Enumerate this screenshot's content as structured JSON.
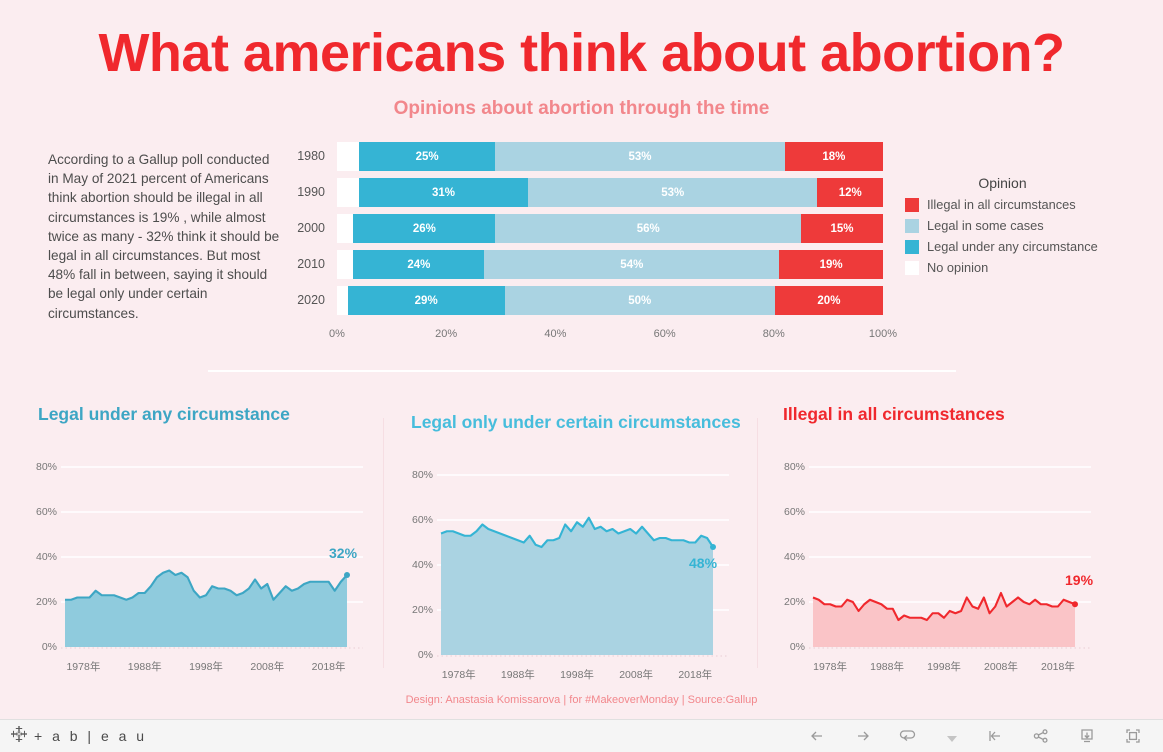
{
  "header": {
    "title": "What americans think about abortion?",
    "subtitle": "Opinions about abortion through the time"
  },
  "intro": {
    "text": "According to a Gallup poll conducted in May of 2021 percent of Americans think abortion should be illegal in all circumstances is 19% , while almost twice as many - 32% think it should be legal in all circumstances. But most 48% fall in between, saying it should be legal only under certain circumstances."
  },
  "colors": {
    "background": "#FBEDF0",
    "red": "#EE3A3A",
    "title_red": "#F0282D",
    "pink": "#F2878C",
    "teal": "#35B4D4",
    "light_blue": "#AAD3E2",
    "white": "#FFFFFF"
  },
  "legend": {
    "title": "Opinion",
    "items": [
      {
        "label": "Illegal in all circumstances",
        "color": "#EE3A3A"
      },
      {
        "label": "Legal in some cases",
        "color": "#AAD3E2"
      },
      {
        "label": "Legal under any circumstance",
        "color": "#35B4D4"
      },
      {
        "label": "No opinion",
        "color": "#FFFFFF"
      }
    ]
  },
  "chart_data": [
    {
      "type": "bar",
      "id": "stacked-opinion-by-decade",
      "orientation": "horizontal",
      "stacked": true,
      "stack_mode": "percent",
      "title": "Opinions about abortion through the time",
      "xlabel": "",
      "ylabel": "",
      "xlim": [
        0,
        100
      ],
      "grid": false,
      "legend_position": "right",
      "categories": [
        "1980",
        "1990",
        "2000",
        "2010",
        "2020"
      ],
      "xticks": [
        "0%",
        "20%",
        "40%",
        "60%",
        "80%",
        "100%"
      ],
      "xtick_values": [
        0,
        20,
        40,
        60,
        80,
        100
      ],
      "series": [
        {
          "name": "No opinion",
          "color": "#FFFFFF",
          "values": [
            4,
            4,
            3,
            3,
            2
          ],
          "labels": [
            "",
            "",
            "",
            "",
            ""
          ]
        },
        {
          "name": "Legal under any circumstance",
          "color": "#35B4D4",
          "values": [
            25,
            31,
            26,
            24,
            29
          ],
          "labels": [
            "25%",
            "31%",
            "26%",
            "24%",
            "29%"
          ]
        },
        {
          "name": "Legal in some cases",
          "color": "#AAD3E2",
          "values": [
            53,
            53,
            56,
            54,
            50
          ],
          "labels": [
            "53%",
            "53%",
            "56%",
            "54%",
            "50%"
          ]
        },
        {
          "name": "Illegal in all circumstances",
          "color": "#EE3A3A",
          "values": [
            18,
            12,
            15,
            19,
            20
          ],
          "labels": [
            "18%",
            "12%",
            "15%",
            "19%",
            "20%"
          ]
        }
      ]
    },
    {
      "type": "area",
      "id": "legal-any-circumstance",
      "title": "Legal under any circumstance",
      "title_color": "#3DA6C4",
      "line_color": "#3DA6C4",
      "fill_color": "#8FCBDD",
      "xlabel": "",
      "ylabel": "",
      "ylim": [
        0,
        88
      ],
      "yticks": [
        "0%",
        "20%",
        "40%",
        "60%",
        "80%"
      ],
      "ytick_values": [
        0,
        20,
        40,
        60,
        80
      ],
      "xticks": [
        "1978年",
        "1988年",
        "1998年",
        "2008年",
        "2018年"
      ],
      "xtick_values": [
        1978,
        1988,
        1998,
        2008,
        2018
      ],
      "end_label": "32%",
      "end_value": 32,
      "x": [
        1975,
        1976,
        1977,
        1978,
        1979,
        1980,
        1981,
        1982,
        1983,
        1984,
        1985,
        1986,
        1987,
        1988,
        1989,
        1990,
        1991,
        1992,
        1993,
        1994,
        1995,
        1996,
        1997,
        1998,
        1999,
        2000,
        2001,
        2002,
        2003,
        2004,
        2005,
        2006,
        2007,
        2008,
        2009,
        2010,
        2011,
        2012,
        2013,
        2014,
        2015,
        2016,
        2017,
        2018,
        2019,
        2020,
        2021
      ],
      "values": [
        21,
        21,
        22,
        22,
        22,
        25,
        23,
        23,
        23,
        22,
        21,
        22,
        24,
        24,
        27,
        31,
        33,
        34,
        32,
        33,
        31,
        25,
        22,
        23,
        27,
        26,
        26,
        25,
        23,
        24,
        26,
        30,
        26,
        28,
        21,
        24,
        27,
        25,
        26,
        28,
        29,
        29,
        29,
        29,
        25,
        29,
        32
      ]
    },
    {
      "type": "area",
      "id": "legal-certain-circumstances",
      "title": "Legal only under certain circumstances",
      "title_color": "#47BDDC",
      "line_color": "#35B4D4",
      "fill_color": "#AAD3E2",
      "xlabel": "",
      "ylabel": "",
      "ylim": [
        0,
        88
      ],
      "yticks": [
        "0%",
        "20%",
        "40%",
        "60%",
        "80%"
      ],
      "ytick_values": [
        0,
        20,
        40,
        60,
        80
      ],
      "xticks": [
        "1978年",
        "1988年",
        "1998年",
        "2008年",
        "2018年"
      ],
      "xtick_values": [
        1978,
        1988,
        1998,
        2008,
        2018
      ],
      "end_label": "48%",
      "end_value": 48,
      "x": [
        1975,
        1976,
        1977,
        1978,
        1979,
        1980,
        1981,
        1982,
        1983,
        1984,
        1985,
        1986,
        1987,
        1988,
        1989,
        1990,
        1991,
        1992,
        1993,
        1994,
        1995,
        1996,
        1997,
        1998,
        1999,
        2000,
        2001,
        2002,
        2003,
        2004,
        2005,
        2006,
        2007,
        2008,
        2009,
        2010,
        2011,
        2012,
        2013,
        2014,
        2015,
        2016,
        2017,
        2018,
        2019,
        2020,
        2021
      ],
      "values": [
        54,
        55,
        55,
        54,
        53,
        53,
        55,
        58,
        56,
        55,
        54,
        53,
        52,
        51,
        50,
        53,
        49,
        48,
        51,
        51,
        52,
        58,
        55,
        59,
        57,
        61,
        56,
        57,
        55,
        56,
        54,
        55,
        56,
        54,
        57,
        54,
        51,
        52,
        52,
        51,
        51,
        51,
        50,
        50,
        53,
        52,
        48
      ]
    },
    {
      "type": "area",
      "id": "illegal-all-circumstances",
      "title": "Illegal in all circumstances",
      "title_color": "#F0282D",
      "line_color": "#F0282D",
      "fill_color": "#FAC4C7",
      "xlabel": "",
      "ylabel": "",
      "ylim": [
        0,
        88
      ],
      "yticks": [
        "0%",
        "20%",
        "40%",
        "60%",
        "80%"
      ],
      "ytick_values": [
        0,
        20,
        40,
        60,
        80
      ],
      "xticks": [
        "1978年",
        "1988年",
        "1998年",
        "2008年",
        "2018年"
      ],
      "xtick_values": [
        1978,
        1988,
        1998,
        2008,
        2018
      ],
      "end_label": "19%",
      "end_value": 19,
      "x": [
        1975,
        1976,
        1977,
        1978,
        1979,
        1980,
        1981,
        1982,
        1983,
        1984,
        1985,
        1986,
        1987,
        1988,
        1989,
        1990,
        1991,
        1992,
        1993,
        1994,
        1995,
        1996,
        1997,
        1998,
        1999,
        2000,
        2001,
        2002,
        2003,
        2004,
        2005,
        2006,
        2007,
        2008,
        2009,
        2010,
        2011,
        2012,
        2013,
        2014,
        2015,
        2016,
        2017,
        2018,
        2019,
        2020,
        2021
      ],
      "values": [
        22,
        21,
        19,
        19,
        18,
        18,
        21,
        20,
        16,
        19,
        21,
        20,
        19,
        17,
        17,
        12,
        14,
        13,
        13,
        13,
        12,
        15,
        15,
        13,
        16,
        15,
        16,
        22,
        18,
        17,
        22,
        15,
        18,
        24,
        18,
        20,
        22,
        20,
        19,
        21,
        19,
        19,
        18,
        18,
        21,
        20,
        19
      ]
    }
  ],
  "credit": {
    "text": "Design: Anastasia Komissarova | for #MakeoverMonday | Source:Gallup"
  },
  "toolbar": {
    "wordmark": "+ a b | e a u",
    "buttons": [
      {
        "name": "undo-button",
        "glyph": "←"
      },
      {
        "name": "redo-button",
        "glyph": "→"
      },
      {
        "name": "revert-button",
        "glyph": "⟲"
      },
      {
        "name": "more-options-caret",
        "glyph": "▾"
      },
      {
        "name": "reset-button",
        "glyph": "|←"
      },
      {
        "name": "share-button",
        "glyph": "share"
      },
      {
        "name": "download-button",
        "glyph": "download"
      },
      {
        "name": "fullscreen-button",
        "glyph": "fullscreen"
      }
    ]
  }
}
